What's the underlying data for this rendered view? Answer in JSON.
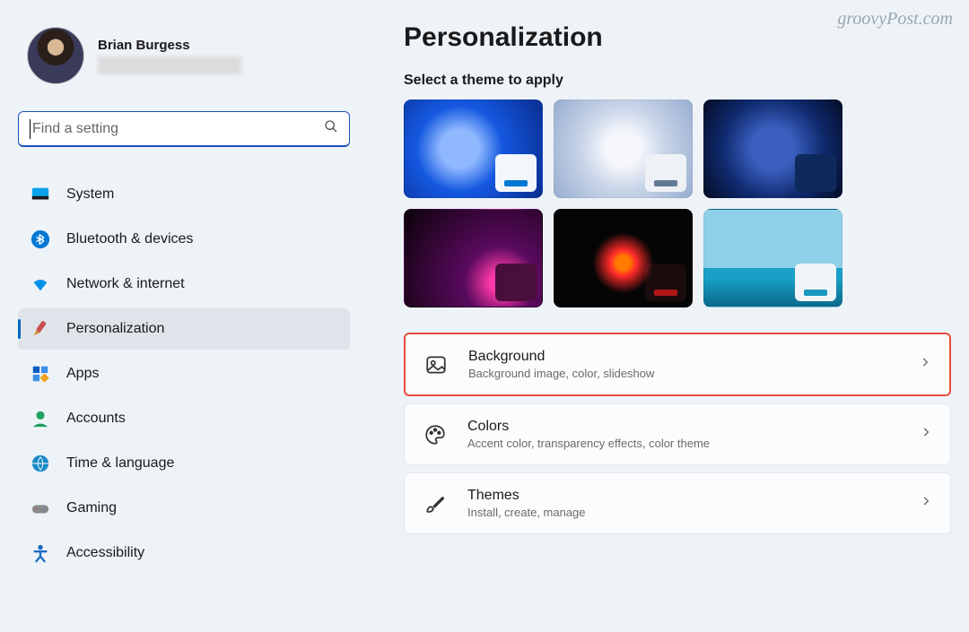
{
  "watermark": "groovyPost.com",
  "profile": {
    "name": "Brian Burgess"
  },
  "search": {
    "placeholder": "Find a setting"
  },
  "nav": {
    "items": [
      {
        "label": "System"
      },
      {
        "label": "Bluetooth & devices"
      },
      {
        "label": "Network & internet"
      },
      {
        "label": "Personalization"
      },
      {
        "label": "Apps"
      },
      {
        "label": "Accounts"
      },
      {
        "label": "Time & language"
      },
      {
        "label": "Gaming"
      },
      {
        "label": "Accessibility"
      }
    ]
  },
  "page": {
    "title": "Personalization",
    "select_theme_label": "Select a theme to apply"
  },
  "settings": {
    "background": {
      "title": "Background",
      "desc": "Background image, color, slideshow"
    },
    "colors": {
      "title": "Colors",
      "desc": "Accent color, transparency effects, color theme"
    },
    "themes": {
      "title": "Themes",
      "desc": "Install, create, manage"
    }
  }
}
